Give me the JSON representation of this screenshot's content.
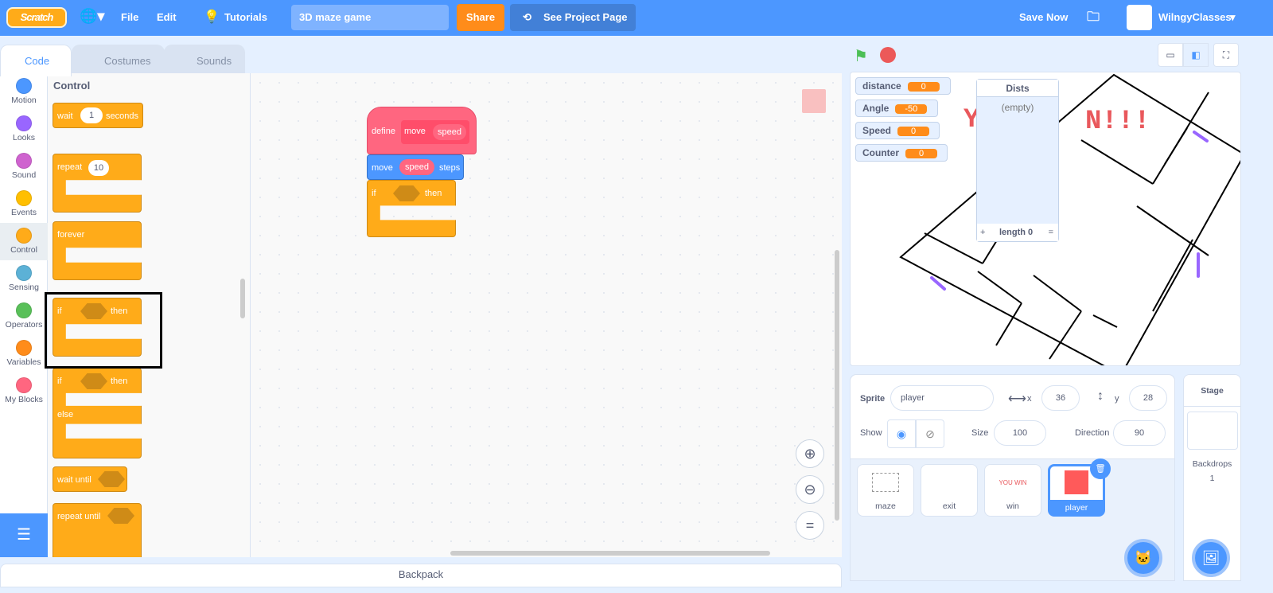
{
  "menu": {
    "logo": "Scratch",
    "file": "File",
    "edit": "Edit",
    "tutorials": "Tutorials",
    "project_title": "3D maze game",
    "share": "Share",
    "see_project": "See Project Page",
    "save_now": "Save Now",
    "username": "WilngyClasses"
  },
  "tabs": [
    {
      "label": "Code"
    },
    {
      "label": "Costumes"
    },
    {
      "label": "Sounds"
    }
  ],
  "categories": [
    {
      "label": "Motion",
      "color": "#4c97ff"
    },
    {
      "label": "Looks",
      "color": "#9966ff"
    },
    {
      "label": "Sound",
      "color": "#cf63cf"
    },
    {
      "label": "Events",
      "color": "#ffbf00"
    },
    {
      "label": "Control",
      "color": "#ffab19"
    },
    {
      "label": "Sensing",
      "color": "#5cb1d6"
    },
    {
      "label": "Operators",
      "color": "#59c059"
    },
    {
      "label": "Variables",
      "color": "#ff8c1a"
    },
    {
      "label": "My Blocks",
      "color": "#ff6680"
    }
  ],
  "palette": {
    "heading": "Control",
    "wait": {
      "a": "wait",
      "v": "1",
      "b": "seconds"
    },
    "repeat": {
      "a": "repeat",
      "v": "10"
    },
    "forever": "forever",
    "if_then": {
      "a": "if",
      "b": "then"
    },
    "if_else": {
      "a": "if",
      "b": "then",
      "c": "else"
    },
    "wait_until": "wait until",
    "repeat_until": "repeat until"
  },
  "script": {
    "define": "define",
    "proc_name": "move",
    "param": "speed",
    "move": "move",
    "move_arg": "speed",
    "steps": "steps",
    "if": "if",
    "then": "then"
  },
  "backpack": "Backpack",
  "stage": {
    "monitors": [
      {
        "name": "distance",
        "value": "0"
      },
      {
        "name": "Angle",
        "value": "-50"
      },
      {
        "name": "Speed",
        "value": "0"
      },
      {
        "name": "Counter",
        "value": "0"
      }
    ],
    "list": {
      "title": "Dists",
      "empty": "(empty)",
      "add": "+",
      "length": "length 0",
      "resize": "="
    },
    "banner": "N!!!"
  },
  "sprite_info": {
    "sprite_label": "Sprite",
    "sprite_name": "player",
    "x_label": "x",
    "x": "36",
    "y_label": "y",
    "y": "28",
    "show_label": "Show",
    "size_label": "Size",
    "size": "100",
    "direction_label": "Direction",
    "direction": "90"
  },
  "sprites": [
    {
      "name": "maze"
    },
    {
      "name": "exit"
    },
    {
      "name": "win",
      "thumb_text": "YOU WIN"
    },
    {
      "name": "player",
      "selected": true
    }
  ],
  "stage_pane": {
    "title": "Stage",
    "backdrops_label": "Backdrops",
    "backdrops_count": "1"
  },
  "colors": {
    "accent": "#4c97ff",
    "control": "#ffab19",
    "custom": "#ff6680",
    "share": "#ff8c1a"
  }
}
